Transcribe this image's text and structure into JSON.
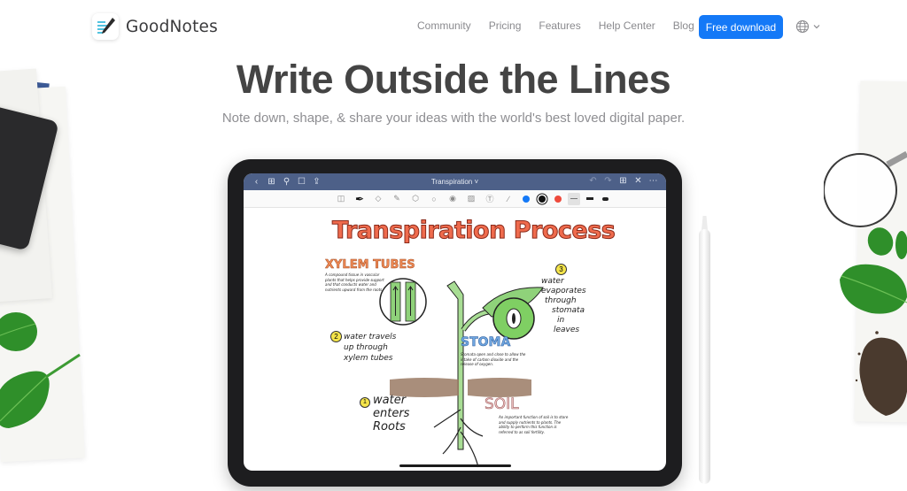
{
  "brand": {
    "name": "GoodNotes",
    "accent": "#1479f7"
  },
  "nav": {
    "links": [
      "Community",
      "Pricing",
      "Features",
      "Help Center",
      "Blog"
    ],
    "cta_label": "Free download",
    "language_icon": "globe-icon"
  },
  "hero": {
    "title": "Write Outside the Lines",
    "subtitle": "Note down, shape, & share your ideas with the world's best loved digital paper."
  },
  "app": {
    "document_title": "Transpiration",
    "topbar_left_icons": [
      "back-icon",
      "grid-icon",
      "search-icon",
      "bookmark-icon",
      "share-icon"
    ],
    "topbar_right_icons": [
      "undo-icon",
      "redo-icon",
      "add-page-icon",
      "close-icon",
      "more-icon"
    ],
    "tools": [
      "sidebar-icon",
      "pen-icon",
      "eraser-icon",
      "highlighter-icon",
      "shapes-icon",
      "lasso-icon",
      "sticker-icon",
      "image-icon",
      "text-icon",
      "laser-icon"
    ],
    "colors": [
      "#1479f7",
      "#111111",
      "#ee4a3c"
    ],
    "selected_color_index": 1,
    "stroke_widths": [
      "thin",
      "medium",
      "thick"
    ],
    "selected_stroke_index": 0
  },
  "note": {
    "title": "Transpiration Process",
    "xylem_heading": "XYLEM TUBES",
    "xylem_text": "A compound tissue in vascular plants that helps provide support and that conducts water and nutrients upward from the roots",
    "step1_number": "1",
    "step1_text": [
      "water",
      "enters",
      "Roots"
    ],
    "step2_number": "2",
    "step2_text": [
      "water travels",
      "up through",
      "xylem tubes"
    ],
    "step3_number": "3",
    "step3_text": [
      "water",
      "evaporates",
      "through",
      "stomata",
      "in",
      "leaves"
    ],
    "stoma_heading": "STOMA",
    "stoma_text": "Stomata open and close to allow the intake of carbon dioxide and the release of oxygen.",
    "soil_heading": "SOIL",
    "soil_text": "An important function of soil is to store and supply nutrients to plants. The ability to perform this function is referred to as soil fertility."
  }
}
